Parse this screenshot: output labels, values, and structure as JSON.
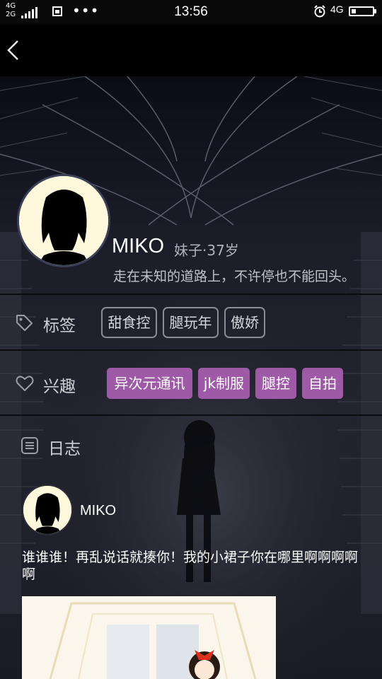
{
  "status_bar": {
    "network_top": "4G",
    "network_bottom": "2G",
    "time": "13:56",
    "right_network": "4G",
    "dots": "•••"
  },
  "profile": {
    "name": "MIKO",
    "meta": "妹子·37岁",
    "bio": "走在未知的道路上，不许停也不能回头。"
  },
  "tags_section": {
    "title": "标签",
    "tags": [
      "甜食控",
      "腿玩年",
      "傲娇"
    ]
  },
  "interests_section": {
    "title": "兴趣",
    "items": [
      "异次元通讯",
      "jk制服",
      "腿控",
      "自拍"
    ],
    "color": "#9e5aa6"
  },
  "diary_section": {
    "title": "日志",
    "post": {
      "author": "MIKO",
      "text": "谁谁谁！再乱说话就揍你！我的小裙子你在哪里啊啊啊啊啊"
    }
  }
}
